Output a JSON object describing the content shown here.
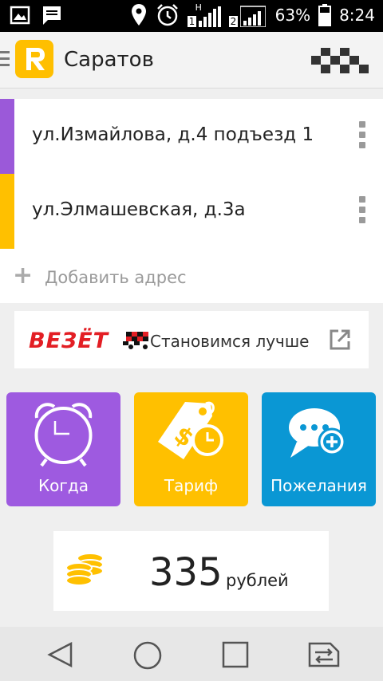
{
  "status_bar": {
    "battery": "63%",
    "time": "8:24",
    "sim1": "1",
    "sim2": "2",
    "net": "H",
    "icons": [
      "image-icon",
      "message-icon",
      "location-icon",
      "alarm-icon",
      "signal-icon",
      "battery-icon"
    ]
  },
  "toolbar": {
    "title": "Саратов"
  },
  "addresses": [
    {
      "text": "ул.Измайлова, д.4 подъезд 1",
      "color": "#9b59d9"
    },
    {
      "text": "ул.Элмашевская, д.3а",
      "color": "#ffc000"
    }
  ],
  "add_address": {
    "label": "Добавить адрес"
  },
  "banner": {
    "brand": "ВЕЗЁТ",
    "text": "Становимся лучше"
  },
  "tiles": [
    {
      "label": "Когда",
      "color": "#9e5ae0",
      "icon": "alarm-clock-icon"
    },
    {
      "label": "Тариф",
      "color": "#ffc000",
      "icon": "price-tag-icon"
    },
    {
      "label": "Пожелания",
      "color": "#0a97d4",
      "icon": "chat-add-icon"
    }
  ],
  "price": {
    "value": "335",
    "currency": "рублей",
    "icon": "coins-icon"
  },
  "colors": {
    "accent": "#ffbf00",
    "brand_red": "#e31e24"
  },
  "nav": {
    "icons": [
      "back-icon",
      "home-icon",
      "recents-icon",
      "sim-switch-icon"
    ]
  }
}
